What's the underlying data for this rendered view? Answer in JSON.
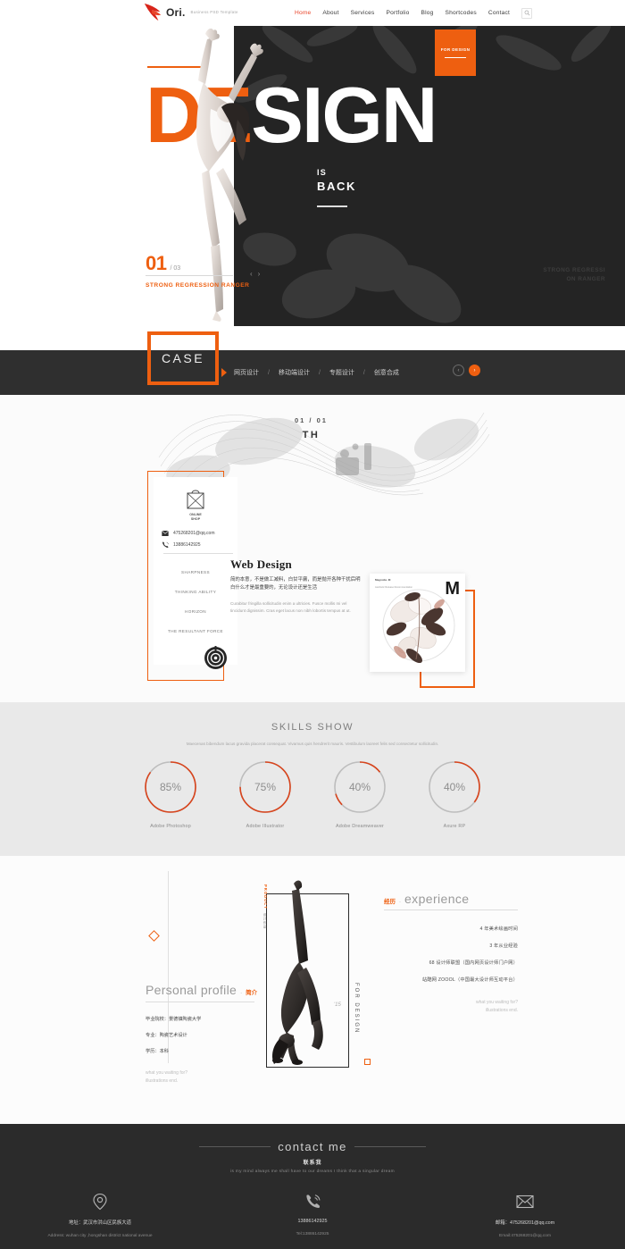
{
  "header": {
    "logo_text": "Ori.",
    "logo_tagline": "Business PSD Template",
    "nav": [
      {
        "label": "Home",
        "active": true
      },
      {
        "label": "About",
        "active": false
      },
      {
        "label": "Services",
        "active": false
      },
      {
        "label": "Portfolio",
        "active": false
      },
      {
        "label": "Blog",
        "active": false
      },
      {
        "label": "Shortcodes",
        "active": false
      },
      {
        "label": "Contact",
        "active": false
      }
    ],
    "search_icon": "search-icon"
  },
  "hero": {
    "badge": "FOR DESIGN",
    "title_orange": "DE",
    "title_white": "SIGN",
    "sub_line1": "IS",
    "sub_line2": "BACK",
    "slide_number": "01",
    "slide_total": "/ 03",
    "caption": "STRONG REGRESSION RANGER",
    "arrow_prev": "‹",
    "arrow_next": "›",
    "watermark_line1": "STRONG REGRESSI",
    "watermark_line2": "ON RANGER",
    "accent_color": "#ee5f10",
    "dark_color": "#242424"
  },
  "case_bar": {
    "label": "CASE",
    "categories": [
      "网页设计",
      "移动端设计",
      "专题设计",
      "创意合成"
    ],
    "separator": "/",
    "prev_icon": "chevron-left-icon",
    "next_icon": "chevron-right-icon"
  },
  "web_design": {
    "counter_top": "01 / 01",
    "counter_bottom": "TH",
    "card": {
      "shop_label_line1": "ONLINE",
      "shop_label_line2": "SHOP",
      "email": "475268201@qq.com",
      "phone": "13886142925",
      "list": [
        "SHARPNESS",
        "THINKING ABILITY",
        "HORIZON",
        "THE RESULTANT FORCE"
      ]
    },
    "title": "Web Design",
    "cn_text": "简的本意，不是做工减料，白甘平庸，而是抛开各种干扰后明白什么才是最重要的，无论设计还是生活",
    "lorem": "Curabitur fringilla sollicitudin enim a ultricies. Fusce mollis mi vel tincidunt dignissim. Cras eget lacus non nibh lobortis tempus at ut.",
    "mcard": {
      "letter": "M",
      "top_title": "Magnolia ·M",
      "top_sub": "Aesthetic Release Recommendation"
    }
  },
  "skills": {
    "title": "SKILLS SHOW",
    "subtitle": "Maecenas bibendum lacus gravida placerat consequat. Vivamus quis hendrerit mauris. Vestibulum laoreet felis sed consectetur sollicitudin.",
    "items": [
      {
        "name": "Adobe Photoshop",
        "percent": 85,
        "label": "85%",
        "active": true
      },
      {
        "name": "Adobe Illustrator",
        "percent": 75,
        "label": "75%",
        "active": true
      },
      {
        "name": "Adobe Dreamweaver",
        "percent": 40,
        "label": "40%",
        "active": false
      },
      {
        "name": "Axure RP",
        "percent": 40,
        "label": "40%",
        "active": false
      }
    ],
    "ring_active_color": "#d8441c",
    "ring_track_color": "#bdbdbd"
  },
  "experience": {
    "cn": "经历",
    "dot": "·",
    "en": "experience",
    "items": [
      "4 年美术绘画时间",
      "3 年从业经验",
      "68 设计师联盟（国内网页设计师门户网）",
      "站酷网 ZOOOL（中国最大设计师互动平台）"
    ],
    "foot_line1": "what you waiting for?",
    "foot_line2": "illustrations end."
  },
  "profile": {
    "en": "Personal profile",
    "dot": "·",
    "cn": "简介",
    "items": [
      "毕业院校：景德镇陶瓷大学",
      "专业：陶瓷艺术设计",
      "学历：本科"
    ],
    "foot_line1": "what you waiting for?",
    "foot_line2": "illustrations end.",
    "vertical_left_a": "PRODUCT",
    "vertical_left_b": "设计作品",
    "vertical_right": "FOR DESIGN",
    "year": "'15"
  },
  "contact": {
    "title_en": "contact me",
    "title_cn": "联系我",
    "subtitle": "is my mind always me shall have to our dreams I think that a singular dream",
    "columns": [
      {
        "icon": "location-pin-icon",
        "line1": "地址：武汉市洪山区民族大道",
        "line2": "Address: wuhan city ,hongshan district national avenue"
      },
      {
        "icon": "phone-icon",
        "line1": "13886142925",
        "line2": "Tel:13886142925"
      },
      {
        "icon": "envelope-icon",
        "line1": "邮箱：475268201@qq.com",
        "line2": "Email:475268201@qq.com"
      }
    ]
  }
}
